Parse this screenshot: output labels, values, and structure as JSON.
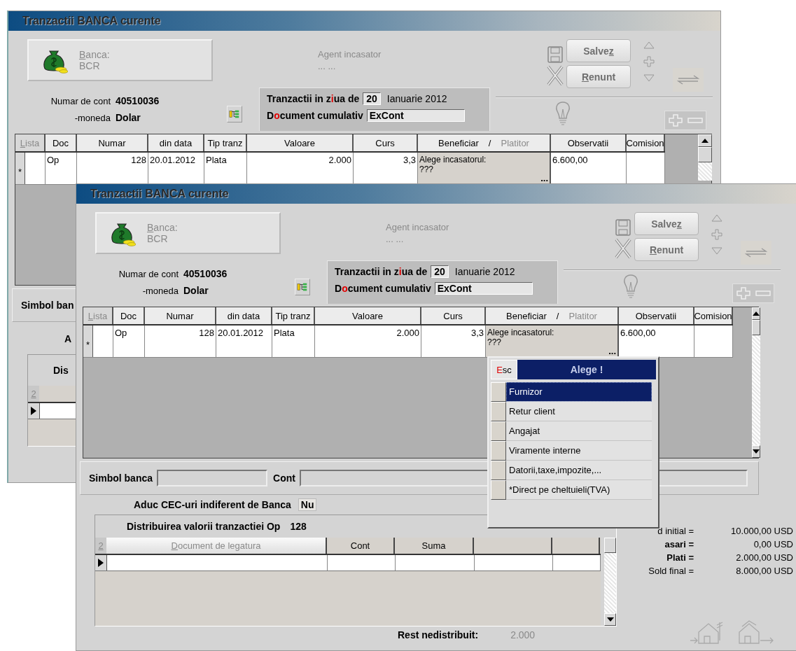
{
  "windows": [
    {
      "title": "Tranzactii BANCA curente",
      "bank_panel": {
        "label_parts": [
          {
            "text": "B",
            "kind": "grey_underline"
          },
          {
            "text": "anca:",
            "kind": "grey"
          }
        ],
        "value": "BCR"
      },
      "agent": {
        "label": "Agent incasator",
        "value": "... ..."
      },
      "buttons": [
        {
          "kind": "save",
          "parts": [
            {
              "text": "Salve",
              "kind": "plain"
            },
            {
              "text": "z",
              "kind": "underline"
            }
          ]
        },
        {
          "kind": "cancel",
          "parts": [
            {
              "text": "R",
              "kind": "underline"
            },
            {
              "text": "enunt",
              "kind": "plain"
            }
          ]
        }
      ],
      "account": {
        "label": "Numar de cont",
        "value": "40510036"
      },
      "currency": {
        "label": "-moneda",
        "value": "Dolar"
      },
      "day": {
        "label_parts": [
          {
            "text": "Tranzactii in z",
            "kind": "plain"
          },
          {
            "text": "i",
            "kind": "hotkey"
          },
          {
            "text": "ua de",
            "kind": "plain"
          }
        ],
        "value": "20",
        "month": "Ianuarie 2012"
      },
      "cumulative": {
        "label_parts": [
          {
            "text": "D",
            "kind": "plain"
          },
          {
            "text": "o",
            "kind": "hotkey"
          },
          {
            "text": "cument cumulativ",
            "kind": "plain"
          }
        ],
        "value": "ExCont"
      },
      "grid": {
        "columns": [
          {
            "kind": "text",
            "parts": [
              {
                "text": "L",
                "kind": "grey_underline"
              },
              {
                "text": "ista",
                "kind": "grey"
              }
            ]
          },
          {
            "kind": "text",
            "parts": [
              {
                "text": "Doc",
                "kind": "plain"
              }
            ]
          },
          {
            "kind": "number",
            "parts": [
              {
                "text": "Numar",
                "kind": "plain"
              }
            ]
          },
          {
            "kind": "text",
            "parts": [
              {
                "text": "din data",
                "kind": "plain"
              }
            ]
          },
          {
            "kind": "text",
            "parts": [
              {
                "text": "Tip tranz",
                "kind": "plain"
              }
            ]
          },
          {
            "kind": "number",
            "parts": [
              {
                "text": "Valoare",
                "kind": "plain"
              }
            ]
          },
          {
            "kind": "number",
            "parts": [
              {
                "text": "Curs",
                "kind": "plain"
              }
            ]
          },
          {
            "kind": "picker",
            "parts": [
              {
                "text": "Beneficiar",
                "kind": "plain"
              },
              {
                "text": "/",
                "kind": "plain"
              },
              {
                "text": "Platitor",
                "kind": "grey"
              }
            ]
          },
          {
            "kind": "text",
            "parts": [
              {
                "text": "Observatii",
                "kind": "plain"
              }
            ]
          },
          {
            "kind": "text",
            "parts": [
              {
                "text": "Comision",
                "kind": "plain"
              }
            ]
          }
        ],
        "rows": [
          {
            "marker": "*",
            "cells": [
              null,
              {
                "text": "Op"
              },
              {
                "text": "128"
              },
              {
                "text": "20.01.2012"
              },
              {
                "text": "Plata"
              },
              {
                "text": "2.000"
              },
              {
                "text": "3,3"
              },
              {
                "lines": [
                  "Alege incasatorul:",
                  "???"
                ],
                "button": "..."
              },
              {
                "text": "6.600,00"
              },
              null
            ]
          }
        ]
      },
      "bank_symbol": {
        "label": "Simbol ban"
      },
      "cec": {
        "label": "A"
      },
      "distribution": {
        "title": "Dis",
        "columns": [
          {
            "kind": "label",
            "parts": [
              {
                "text": "2",
                "kind": "grey_underline"
              }
            ]
          }
        ],
        "rows": [
          {
            "current": true
          }
        ]
      }
    },
    {
      "title": "Tranzactii BANCA curente",
      "bank_panel": {
        "label_parts": [
          {
            "text": "B",
            "kind": "grey_underline"
          },
          {
            "text": "anca:",
            "kind": "grey"
          }
        ],
        "value": "BCR"
      },
      "agent": {
        "label": "Agent incasator",
        "value": "... ..."
      },
      "buttons": [
        {
          "kind": "save",
          "parts": [
            {
              "text": "Salve",
              "kind": "plain"
            },
            {
              "text": "z",
              "kind": "underline"
            }
          ]
        },
        {
          "kind": "cancel",
          "parts": [
            {
              "text": "R",
              "kind": "underline"
            },
            {
              "text": "enunt",
              "kind": "plain"
            }
          ]
        }
      ],
      "account": {
        "label": "Numar de cont",
        "value": "40510036"
      },
      "currency": {
        "label": "-moneda",
        "value": "Dolar"
      },
      "day": {
        "label_parts": [
          {
            "text": "Tranzactii in z",
            "kind": "plain"
          },
          {
            "text": "i",
            "kind": "hotkey"
          },
          {
            "text": "ua de",
            "kind": "plain"
          }
        ],
        "value": "20",
        "month": "Ianuarie 2012"
      },
      "cumulative": {
        "label_parts": [
          {
            "text": "D",
            "kind": "plain"
          },
          {
            "text": "o",
            "kind": "hotkey"
          },
          {
            "text": "cument cumulativ",
            "kind": "plain"
          }
        ],
        "value": "ExCont"
      },
      "grid": {
        "columns": [
          {
            "kind": "text",
            "parts": [
              {
                "text": "L",
                "kind": "grey_underline"
              },
              {
                "text": "ista",
                "kind": "grey"
              }
            ]
          },
          {
            "kind": "text",
            "parts": [
              {
                "text": "Doc",
                "kind": "plain"
              }
            ]
          },
          {
            "kind": "number",
            "parts": [
              {
                "text": "Numar",
                "kind": "plain"
              }
            ]
          },
          {
            "kind": "text",
            "parts": [
              {
                "text": "din data",
                "kind": "plain"
              }
            ]
          },
          {
            "kind": "text",
            "parts": [
              {
                "text": "Tip tranz",
                "kind": "plain"
              }
            ]
          },
          {
            "kind": "number",
            "parts": [
              {
                "text": "Valoare",
                "kind": "plain"
              }
            ]
          },
          {
            "kind": "number",
            "parts": [
              {
                "text": "Curs",
                "kind": "plain"
              }
            ]
          },
          {
            "kind": "picker",
            "parts": [
              {
                "text": "Beneficiar",
                "kind": "plain"
              },
              {
                "text": "/",
                "kind": "plain"
              },
              {
                "text": "Platitor",
                "kind": "grey"
              }
            ]
          },
          {
            "kind": "text",
            "parts": [
              {
                "text": "Observatii",
                "kind": "plain"
              }
            ]
          },
          {
            "kind": "text",
            "parts": [
              {
                "text": "Comision",
                "kind": "plain"
              }
            ]
          }
        ],
        "rows": [
          {
            "marker": "*",
            "cells": [
              null,
              {
                "text": "Op"
              },
              {
                "text": "128"
              },
              {
                "text": "20.01.2012"
              },
              {
                "text": "Plata"
              },
              {
                "text": "2.000"
              },
              {
                "text": "3,3"
              },
              {
                "lines": [
                  "Alege incasatorul:",
                  "???"
                ],
                "button": "..."
              },
              {
                "text": "6.600,00"
              },
              null
            ]
          }
        ]
      },
      "bank_symbol": {
        "label": "Simbol banca"
      },
      "cont": {
        "label": "Cont"
      },
      "cec": {
        "label": "Aduc CEC-uri indiferent de Banca",
        "value": "Nu"
      },
      "distribution": {
        "title": "Distribuirea valorii tranzactiei Op",
        "doc_number": "128",
        "columns": [
          {
            "kind": "label",
            "parts": [
              {
                "text": "2",
                "kind": "grey_underline"
              }
            ]
          },
          {
            "kind": "label",
            "parts": [
              {
                "text": "D",
                "kind": "grey_underline"
              },
              {
                "text": "ocument de legatura",
                "kind": "grey"
              }
            ]
          },
          {
            "kind": "label",
            "parts": [
              {
                "text": "Cont",
                "kind": "plain"
              }
            ]
          },
          {
            "kind": "label",
            "parts": [
              {
                "text": "Suma",
                "kind": "plain"
              }
            ]
          },
          {
            "kind": "blank"
          },
          {
            "kind": "blank"
          }
        ],
        "rows": [
          {
            "current": true
          }
        ]
      },
      "rest": {
        "label": "Rest nedistribuit:",
        "value": "2.000"
      },
      "totals": [
        {
          "label": "d initial =",
          "value": "10.000,00 USD",
          "bold": false
        },
        {
          "label": "asari =",
          "value": "0,00 USD",
          "bold": true
        },
        {
          "label": "Plati =",
          "value": "2.000,00 USD",
          "bold": true
        },
        {
          "label": "Sold final =",
          "value": "8.000,00 USD",
          "bold": false
        }
      ],
      "popup": {
        "esc_parts": [
          {
            "text": "E",
            "kind": "hotkey"
          },
          {
            "text": "sc",
            "kind": "plain"
          }
        ],
        "title": "Alege !",
        "items": [
          {
            "label": "Furnizor",
            "selected": true
          },
          {
            "label": "Retur client",
            "selected": false
          },
          {
            "label": "Angajat",
            "selected": false
          },
          {
            "label": "Viramente interne",
            "selected": false
          },
          {
            "label": "Datorii,taxe,impozite,...",
            "selected": false
          },
          {
            "label": "*Direct pe cheltuieli(TVA)",
            "selected": false
          }
        ]
      }
    }
  ]
}
